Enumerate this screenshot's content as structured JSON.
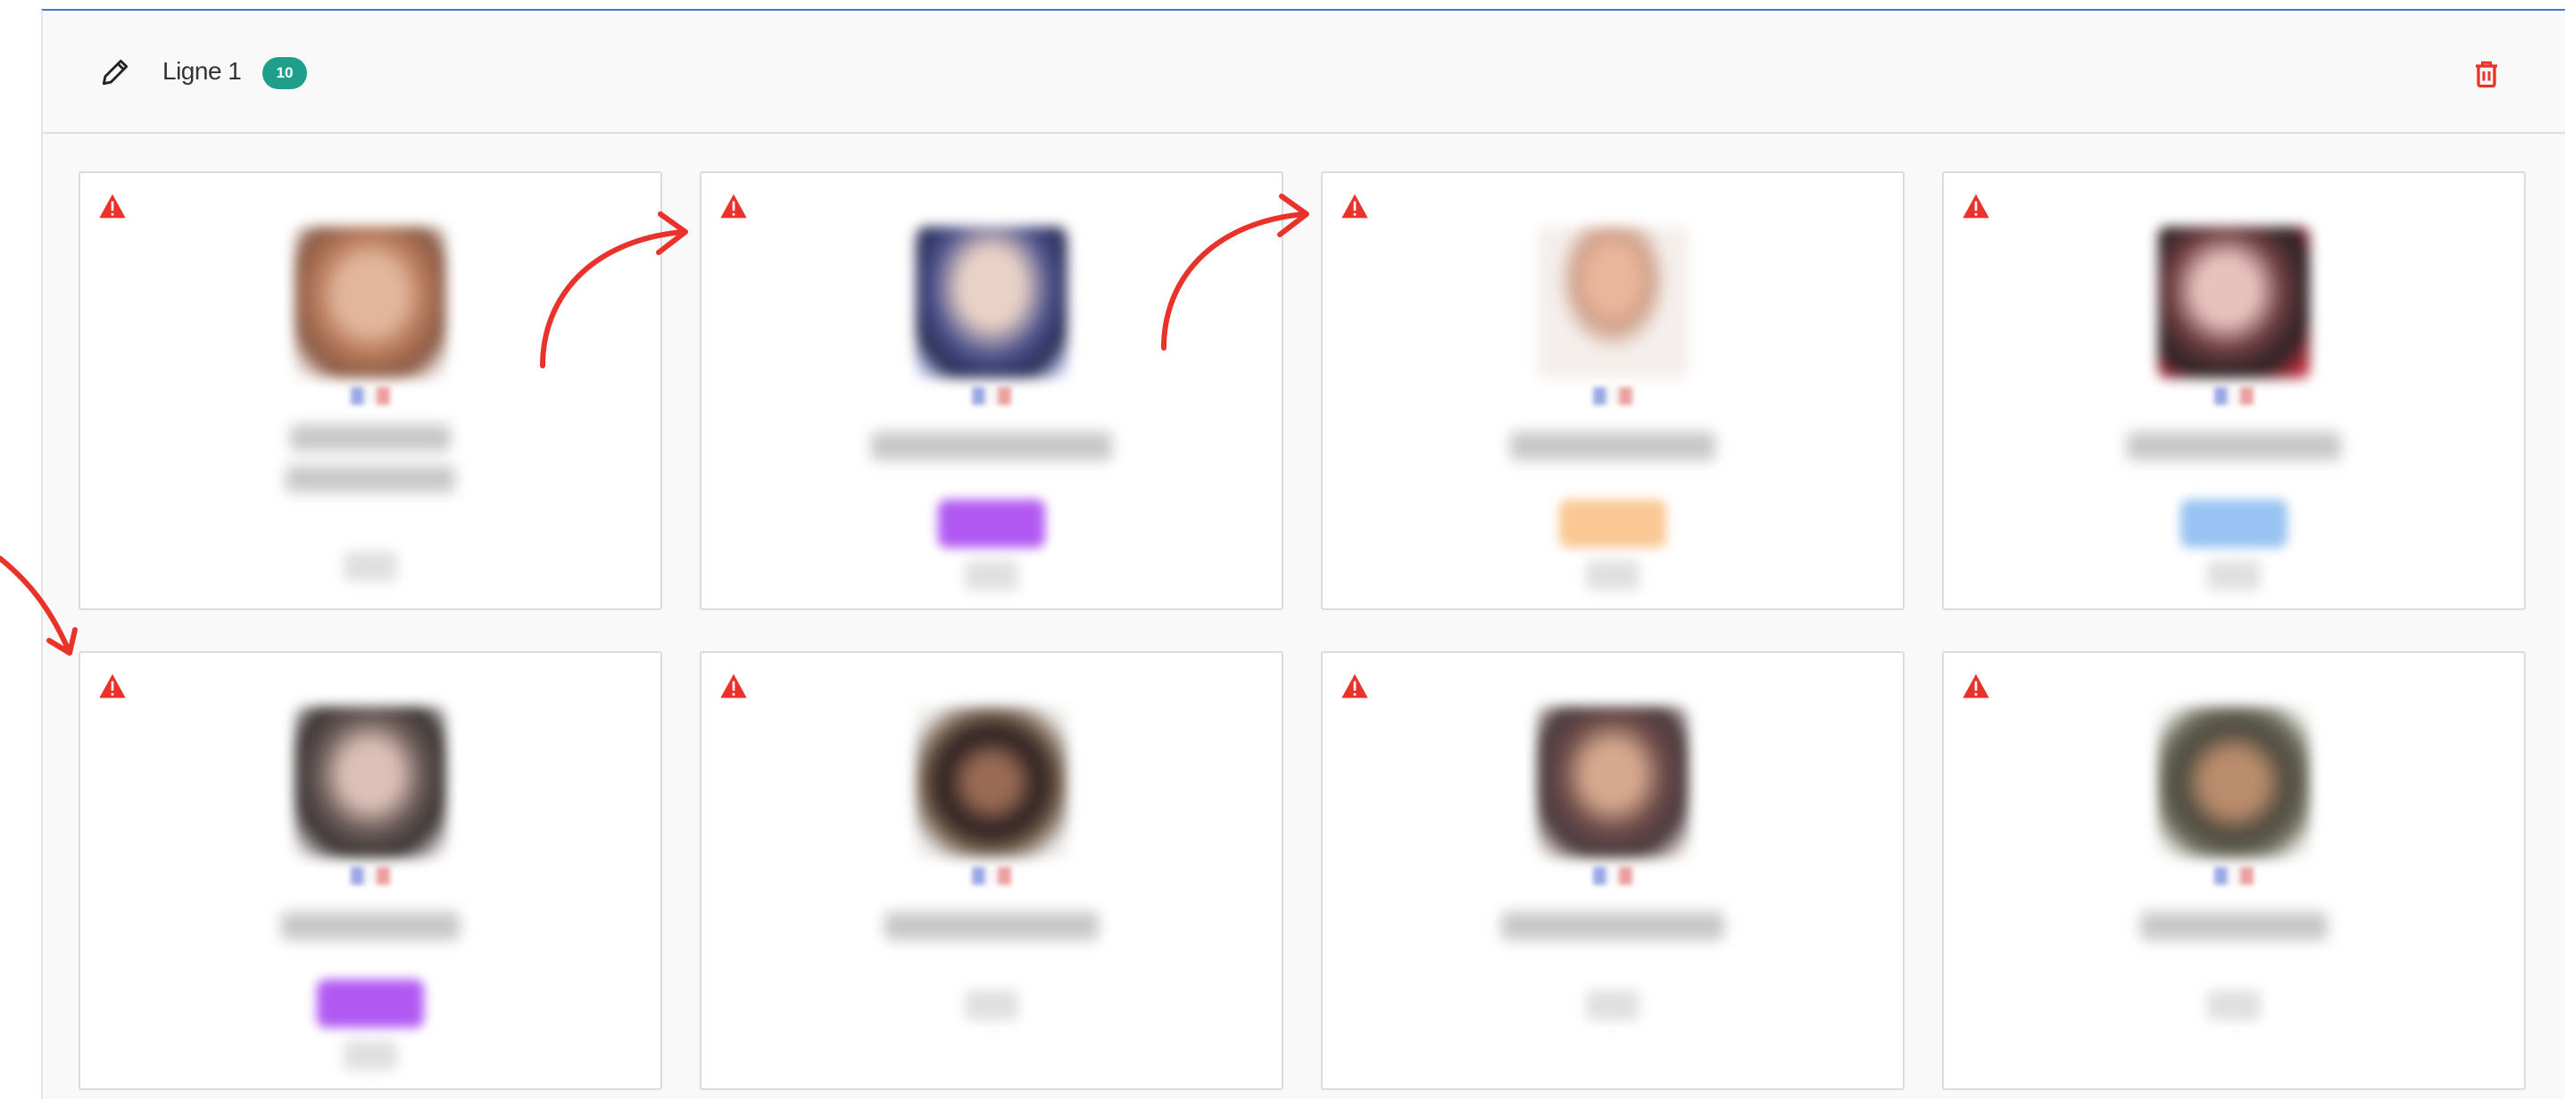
{
  "header": {
    "row_title": "Ligne 1",
    "count": "10",
    "edit_icon": "pencil-icon",
    "delete_icon": "trash-icon"
  },
  "cards": [
    {
      "status_icon": "warning-icon",
      "tag": "none"
    },
    {
      "status_icon": "warning-icon",
      "tag": "purple"
    },
    {
      "status_icon": "warning-icon",
      "tag": "orange"
    },
    {
      "status_icon": "warning-icon",
      "tag": "blue"
    },
    {
      "status_icon": "warning-icon",
      "tag": "purple"
    },
    {
      "status_icon": "warning-icon",
      "tag": "none"
    },
    {
      "status_icon": "warning-icon",
      "tag": "none"
    },
    {
      "status_icon": "warning-icon",
      "tag": "none"
    }
  ],
  "colors": {
    "accent_border": "#3a7bd5",
    "badge": "#1f9e8c",
    "warning": "#e8322a",
    "annotation_arrow": "#e8322a"
  }
}
